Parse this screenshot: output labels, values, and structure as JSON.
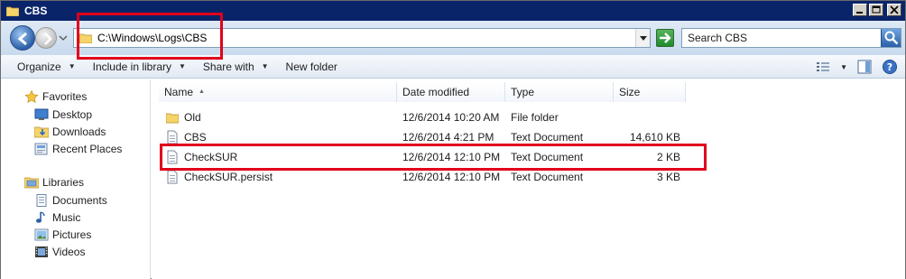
{
  "window": {
    "title": "CBS"
  },
  "address_bar": {
    "path": "C:\\Windows\\Logs\\CBS",
    "search_placeholder": "Search CBS"
  },
  "toolbar": {
    "organize": "Organize",
    "include_in_library": "Include in library",
    "share_with": "Share with",
    "new_folder": "New folder"
  },
  "sidebar": {
    "favorites_label": "Favorites",
    "favorites": [
      {
        "label": "Desktop",
        "icon": "desktop-icon"
      },
      {
        "label": "Downloads",
        "icon": "downloads-icon"
      },
      {
        "label": "Recent Places",
        "icon": "recent-places-icon"
      }
    ],
    "libraries_label": "Libraries",
    "libraries": [
      {
        "label": "Documents",
        "icon": "documents-icon"
      },
      {
        "label": "Music",
        "icon": "music-icon"
      },
      {
        "label": "Pictures",
        "icon": "pictures-icon"
      },
      {
        "label": "Videos",
        "icon": "videos-icon"
      }
    ]
  },
  "file_list": {
    "columns": [
      "Name",
      "Date modified",
      "Type",
      "Size"
    ],
    "rows": [
      {
        "name": "Old",
        "date_modified": "12/6/2014 10:20 AM",
        "type": "File folder",
        "size": "",
        "icon": "folder-icon"
      },
      {
        "name": "CBS",
        "date_modified": "12/6/2014 4:21 PM",
        "type": "Text Document",
        "size": "14,610 KB",
        "icon": "text-document-icon"
      },
      {
        "name": "CheckSUR",
        "date_modified": "12/6/2014 12:10 PM",
        "type": "Text Document",
        "size": "2 KB",
        "icon": "text-document-icon"
      },
      {
        "name": "CheckSUR.persist",
        "date_modified": "12/6/2014 12:10 PM",
        "type": "Text Document",
        "size": "3 KB",
        "icon": "text-document-icon"
      }
    ]
  },
  "colors": {
    "annotation": "#e0001c",
    "titlebar": "#0a246a"
  }
}
